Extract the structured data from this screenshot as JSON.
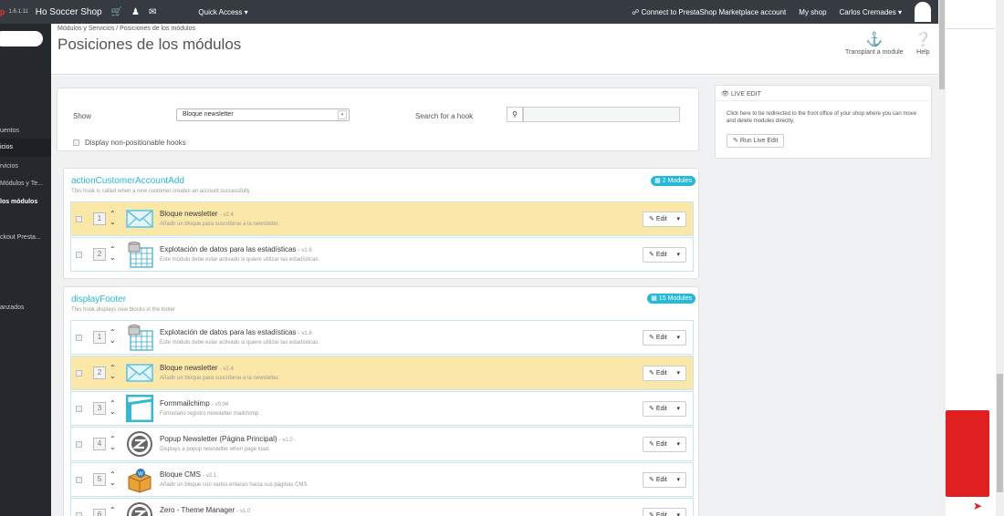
{
  "topbar": {
    "logo": "p",
    "version": "1.6.1.11",
    "shop_name": "Ho Soccer Shop",
    "quick_access": "Quick Access ▾",
    "connect": "Connect to PrestaShop Marketplace account",
    "my_shop": "My shop",
    "user": "Carlos Cremades ▾"
  },
  "sidebar": {
    "items": [
      {
        "label": "uentos",
        "active": false
      },
      {
        "label": "icios",
        "active": true
      },
      {
        "label": "rvicios",
        "active": false
      },
      {
        "label": "Módulos y Te...",
        "active": false
      },
      {
        "label": "los módulos",
        "active": false
      },
      {
        "label": "ckout Presta...",
        "active": false
      },
      {
        "label": "anzados",
        "active": false
      }
    ]
  },
  "header": {
    "breadcrumb": "Módulos y Servicios  /  Posiciones de los módulos",
    "title": "Posiciones de los módulos",
    "transplant_label": "Transplant a module",
    "help_label": "Help"
  },
  "filter": {
    "show_label": "Show",
    "show_value": "Bloque newsletter",
    "search_label": "Search for a hook",
    "search_value": "",
    "nonpos_label": "Display non-positionable hooks"
  },
  "live_edit": {
    "heading": "LIVE EDIT",
    "text": "Click here to be redirected to the front office of your shop where you can move and delete modules directly.",
    "button": "Run Live Edit"
  },
  "edit_label": "Edit",
  "hooks": [
    {
      "name": "actionCustomerAccountAdd",
      "desc": "This hook is called when a new customer creates an account successfully",
      "badge": "2 Modules",
      "modules": [
        {
          "pos": "1",
          "name": "Bloque newsletter",
          "version": "- v2.4",
          "desc": "Añadir un bloque para suscribirse a la newsletter.",
          "icon": "envelope-icon",
          "highlight": true
        },
        {
          "pos": "2",
          "name": "Explotación de datos para las estadísticas",
          "version": "- v1.6",
          "desc": "Este módulo debe estar activado si quiere utilizar las estadísticas.",
          "icon": "database-grid-icon",
          "highlight": false
        }
      ]
    },
    {
      "name": "displayFooter",
      "desc": "This hook displays new blocks in the footer",
      "badge": "15 Modules",
      "modules": [
        {
          "pos": "1",
          "name": "Explotación de datos para las estadísticas",
          "version": "- v1.6",
          "desc": "Este módulo debe estar activado si quiere utilizar las estadísticas.",
          "icon": "database-grid-icon",
          "highlight": false
        },
        {
          "pos": "2",
          "name": "Bloque newsletter",
          "version": "- v2.4",
          "desc": "Añadir un bloque para suscribirse a la newsletter.",
          "icon": "envelope-icon",
          "highlight": true
        },
        {
          "pos": "3",
          "name": "Formmailchimp",
          "version": "- v0.04",
          "desc": "Formulario registro newsletter mailchimp",
          "icon": "form-icon",
          "highlight": false
        },
        {
          "pos": "4",
          "name": "Popup Newsletter (Página Principal)",
          "version": "- v1.0 -",
          "desc": "Displays a popup newsletter when page load.",
          "icon": "z-logo-icon",
          "highlight": false
        },
        {
          "pos": "5",
          "name": "Bloque CMS",
          "version": "- v2.1",
          "desc": "Añadir un bloque con varios enlaces hacia sus páginas CMS.",
          "icon": "box-icon",
          "highlight": false
        },
        {
          "pos": "6",
          "name": "Zero - Theme Manager",
          "version": "- v1.0",
          "desc": "",
          "icon": "z-logo-icon",
          "highlight": false
        }
      ]
    }
  ],
  "colors": {
    "accent": "#25b9d7",
    "highlight": "#fbe7a8",
    "topbar": "#363a41",
    "sidebar": "#25282d"
  }
}
